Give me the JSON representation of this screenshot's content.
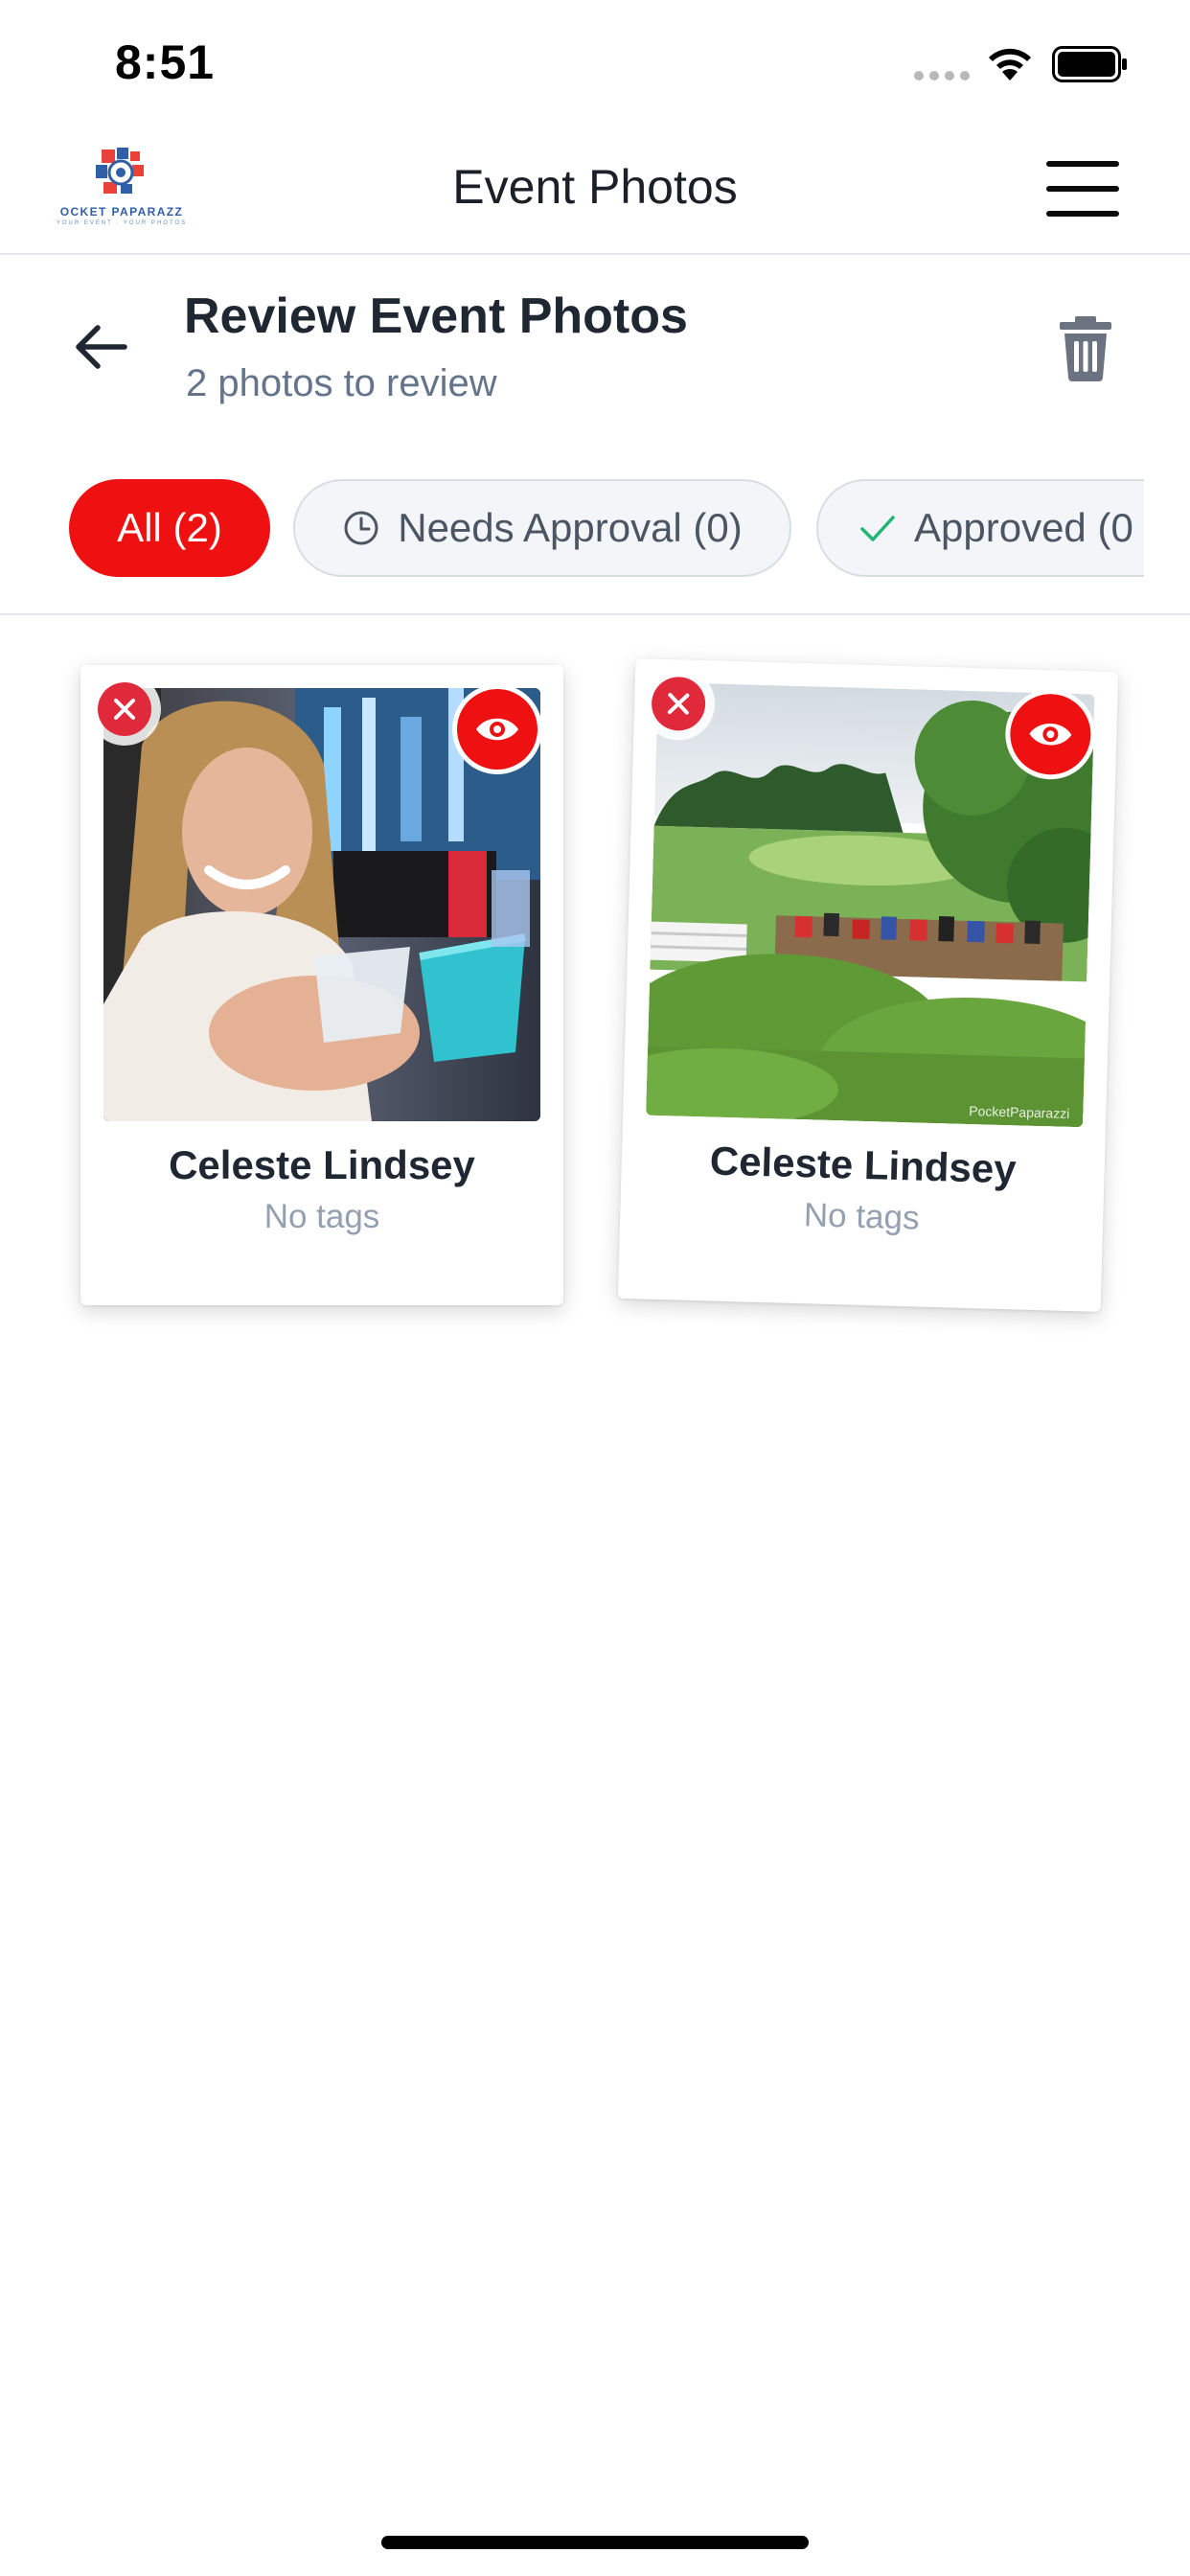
{
  "status_bar": {
    "time": "8:51"
  },
  "header": {
    "title": "Event Photos",
    "brand": {
      "name": "OCKET PAPARAZZ",
      "tagline": "YOUR EVENT · YOUR PHOTOS"
    }
  },
  "page": {
    "title": "Review Event Photos",
    "subtitle": "2 photos to review"
  },
  "filters": [
    {
      "label": "All (2)",
      "active": true
    },
    {
      "label": "Needs Approval (0)",
      "icon": "clock-icon"
    },
    {
      "label": "Approved (0",
      "icon": "check-icon"
    }
  ],
  "photos": [
    {
      "name": "Celeste Lindsey",
      "tags": "No tags"
    },
    {
      "name": "Celeste Lindsey",
      "tags": "No tags",
      "watermark": "PocketPaparazzi"
    }
  ],
  "colors": {
    "accent": "#ef1111",
    "remove": "#e02a3b",
    "approved_check": "#22b573",
    "text_primary": "#1f2733",
    "text_muted": "#64748b"
  }
}
